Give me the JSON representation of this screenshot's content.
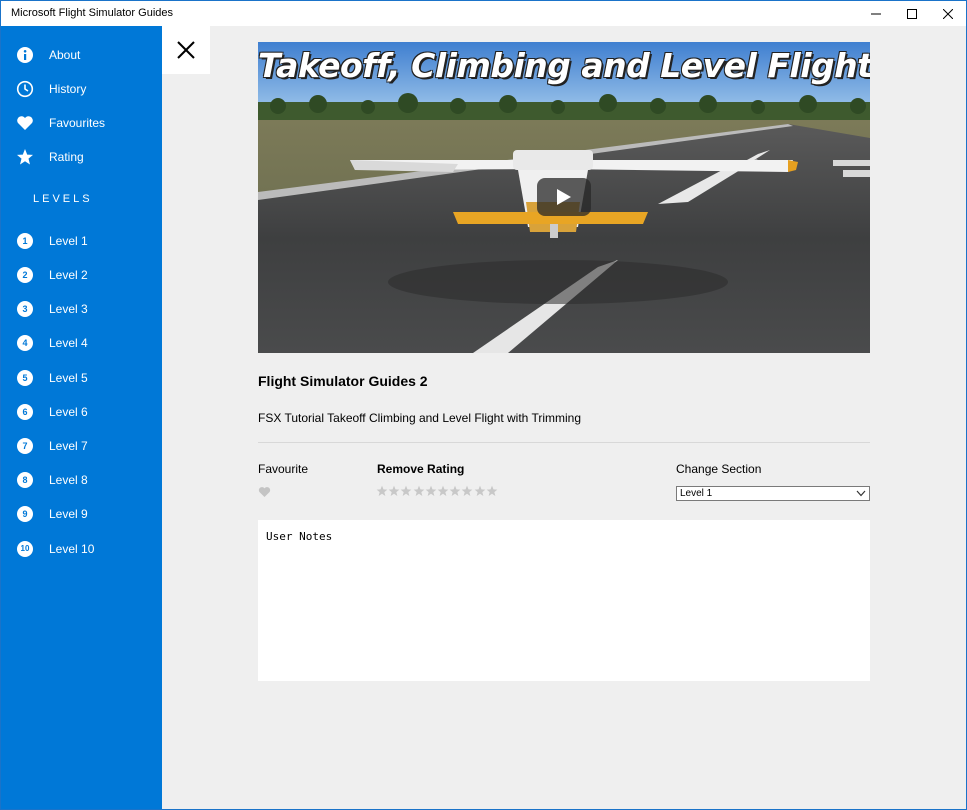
{
  "window": {
    "title": "Microsoft Flight Simulator Guides"
  },
  "sidebar": {
    "items": [
      {
        "label": "About",
        "icon": "info-icon"
      },
      {
        "label": "History",
        "icon": "clock-icon"
      },
      {
        "label": "Favourites",
        "icon": "heart-icon"
      },
      {
        "label": "Rating",
        "icon": "star-icon"
      }
    ],
    "levels_header": "LEVELS",
    "levels": [
      {
        "num": "1",
        "label": "Level 1"
      },
      {
        "num": "2",
        "label": "Level 2"
      },
      {
        "num": "3",
        "label": "Level 3"
      },
      {
        "num": "4",
        "label": "Level 4"
      },
      {
        "num": "5",
        "label": "Level 5"
      },
      {
        "num": "6",
        "label": "Level 6"
      },
      {
        "num": "7",
        "label": "Level 7"
      },
      {
        "num": "8",
        "label": "Level 8"
      },
      {
        "num": "9",
        "label": "Level 9"
      },
      {
        "num": "10",
        "label": "Level 10"
      }
    ]
  },
  "video": {
    "overlay_title": "Takeoff, Climbing and Level Flight"
  },
  "guide": {
    "title": "Flight Simulator Guides 2",
    "description": "FSX Tutorial Takeoff Climbing and Level Flight with Trimming"
  },
  "controls": {
    "favourite_label": "Favourite",
    "rating_label": "Remove Rating",
    "rating_value": 0,
    "rating_max": 10,
    "section_label": "Change Section",
    "section_selected": "Level 1"
  },
  "notes": {
    "text": "User Notes"
  },
  "colors": {
    "accent": "#0078d7",
    "sidebar_text": "#ffffff",
    "content_bg": "#efefef",
    "star_empty": "#c8c8c8"
  }
}
